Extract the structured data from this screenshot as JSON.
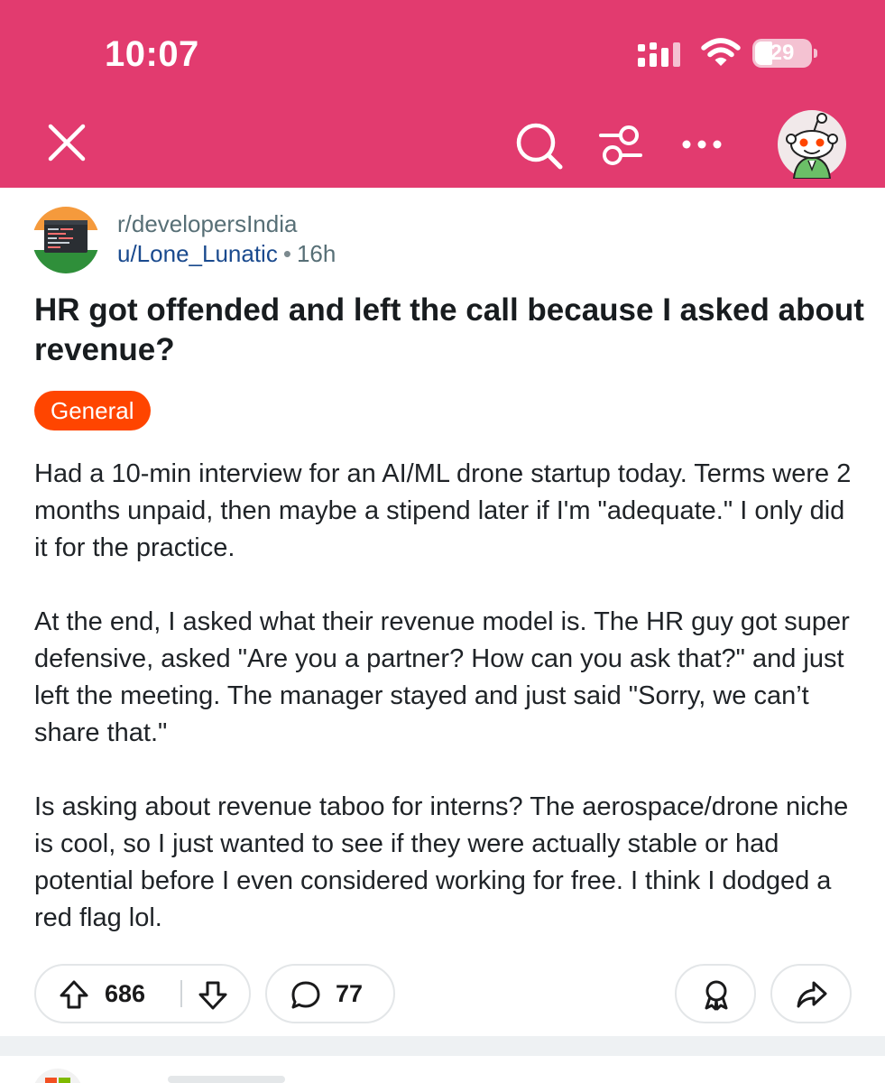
{
  "status_bar": {
    "time": "10:07",
    "battery_text": "29",
    "icons": [
      "cellular-signal-icon",
      "wifi-icon",
      "battery-icon"
    ]
  },
  "header": {
    "icons": [
      "close-icon",
      "search-icon",
      "filter-icon",
      "more-icon",
      "snoo-avatar"
    ],
    "background": "#e23b6f"
  },
  "post": {
    "subreddit": "r/developersIndia",
    "author": "u/Lone_Lunatic",
    "separator": "•",
    "age": "16h",
    "title": "HR got offended and left the call because I asked about revenue?",
    "flair": "General",
    "flair_color": "#ff4500",
    "paragraphs": [
      "Had a 10-min interview for an AI/ML drone startup today. Terms were 2 months unpaid, then maybe a stipend later if I'm \"adequate.\" I only did it for the practice.",
      "At the end, I asked what their revenue model is. The HR guy got super defensive, asked \"Are you a partner? How can you ask that?\" and just left the meeting. The manager stayed and just said \"Sorry, we can’t share that.\"",
      "Is asking about revenue taboo for interns? The aerospace/drone niche is cool, so I just wanted to see if they were actually stable or had potential before I even considered working for free. I think I dodged a red flag lol."
    ]
  },
  "actions": {
    "upvotes": "686",
    "comments": "77",
    "icons": [
      "upvote-icon",
      "downvote-icon",
      "comment-icon",
      "award-icon",
      "share-icon"
    ]
  }
}
